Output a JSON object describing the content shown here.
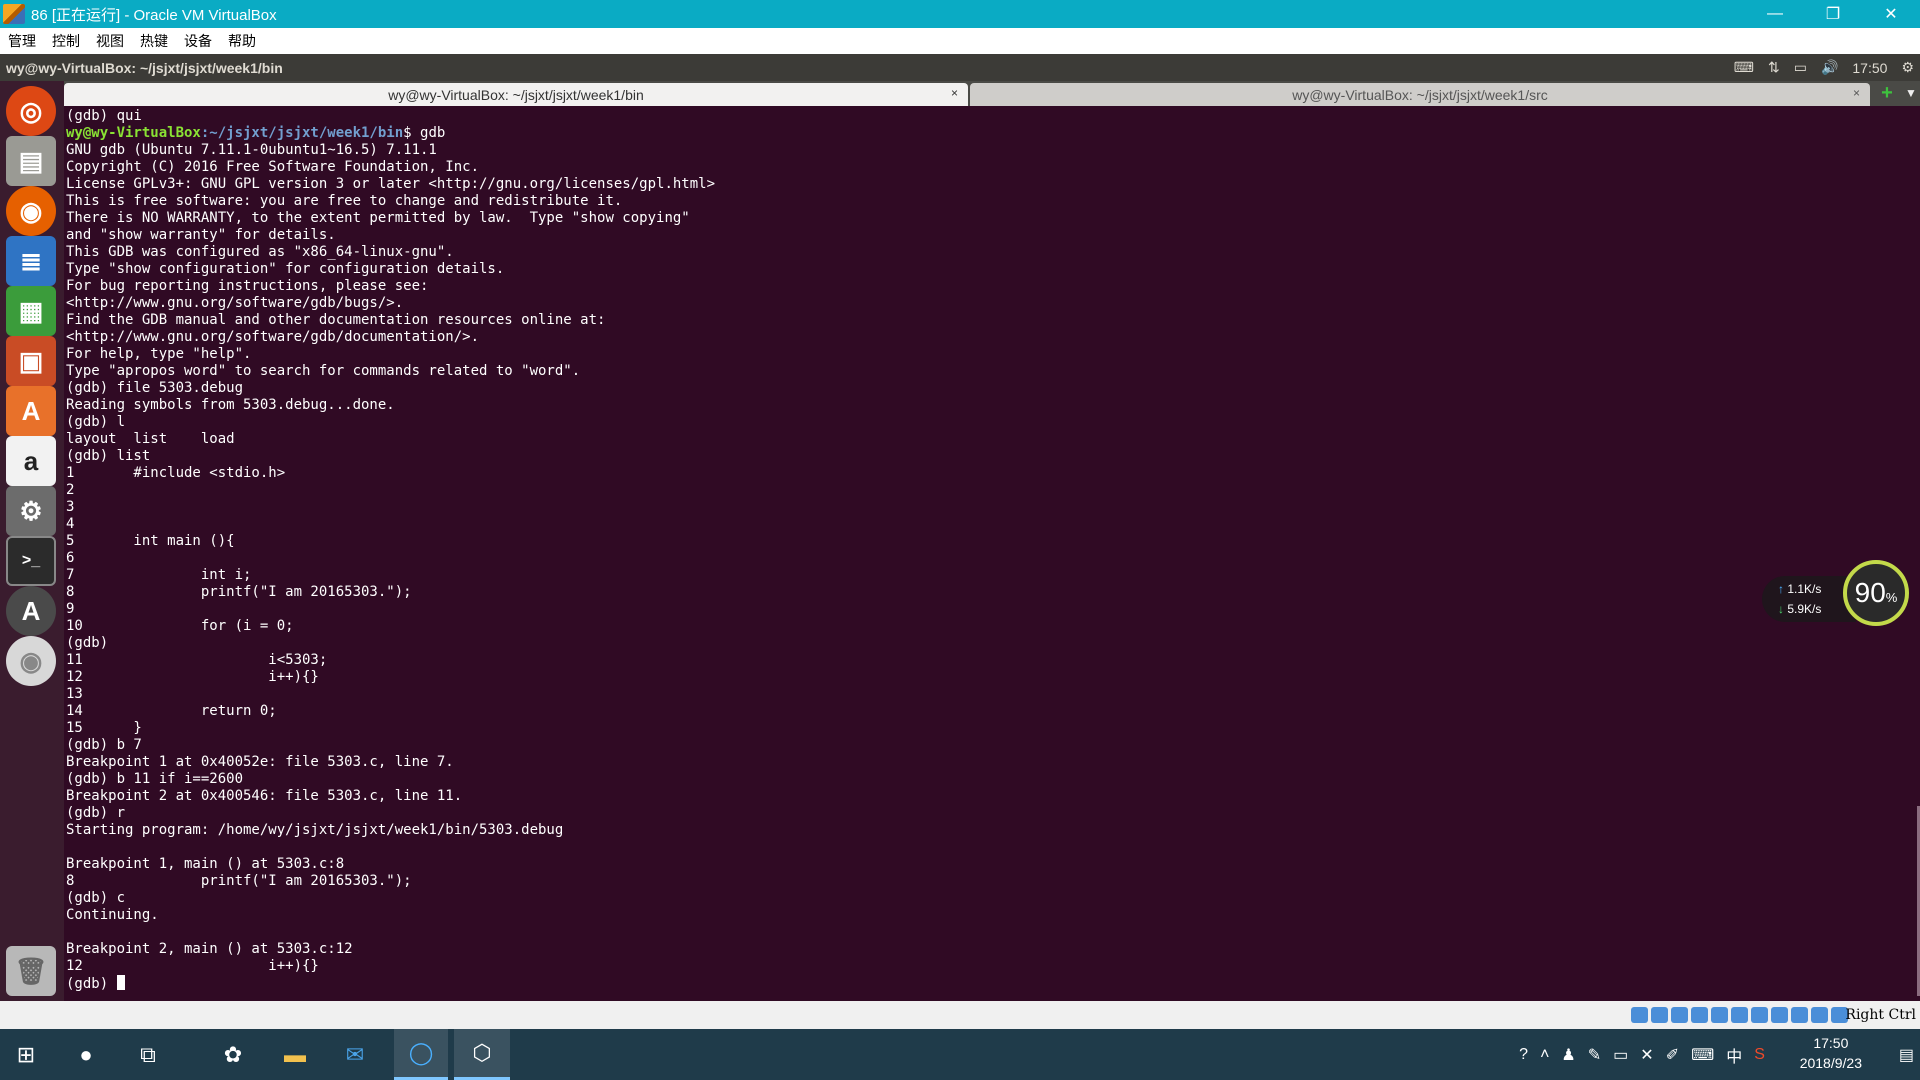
{
  "host_window": {
    "title": "86 [正在运行] - Oracle VM VirtualBox",
    "controls": [
      "—",
      "❐",
      "✕"
    ]
  },
  "vb_menu": [
    "管理",
    "控制",
    "视图",
    "热键",
    "设备",
    "帮助"
  ],
  "ubuntu_panel": {
    "title": "wy@wy-VirtualBox: ~/jsjxt/jsjxt/week1/bin",
    "time": "17:50"
  },
  "launcher_icons": [
    "ubuntu-dash-icon",
    "files-icon",
    "firefox-icon",
    "writer-icon",
    "calc-icon",
    "impress-icon",
    "software-center-icon",
    "amazon-icon",
    "system-settings-icon",
    "terminal-icon",
    "software-updater-icon",
    "dvd-icon",
    "trash-icon"
  ],
  "tabs": [
    {
      "label": "wy@wy-VirtualBox: ~/jsjxt/jsjxt/week1/bin",
      "close": "×"
    },
    {
      "label": "wy@wy-VirtualBox: ~/jsjxt/jsjxt/week1/src",
      "close": "×"
    }
  ],
  "terminal": {
    "line_first": "(gdb) qui",
    "prompt_user": "wy@wy-VirtualBox",
    "prompt_path": ":~/jsjxt/jsjxt/week1/bin",
    "prompt_cmd": "$ gdb",
    "body": "GNU gdb (Ubuntu 7.11.1-0ubuntu1~16.5) 7.11.1\nCopyright (C) 2016 Free Software Foundation, Inc.\nLicense GPLv3+: GNU GPL version 3 or later <http://gnu.org/licenses/gpl.html>\nThis is free software: you are free to change and redistribute it.\nThere is NO WARRANTY, to the extent permitted by law.  Type \"show copying\"\nand \"show warranty\" for details.\nThis GDB was configured as \"x86_64-linux-gnu\".\nType \"show configuration\" for configuration details.\nFor bug reporting instructions, please see:\n<http://www.gnu.org/software/gdb/bugs/>.\nFind the GDB manual and other documentation resources online at:\n<http://www.gnu.org/software/gdb/documentation/>.\nFor help, type \"help\".\nType \"apropos word\" to search for commands related to \"word\".\n(gdb) file 5303.debug\nReading symbols from 5303.debug...done.\n(gdb) l\nlayout  list    load\n(gdb) list\n1       #include <stdio.h>\n2\n3\n4\n5       int main (){\n6\n7               int i;\n8               printf(\"I am 20165303.\");\n9\n10              for (i = 0;\n(gdb)\n11                      i<5303;\n12                      i++){}\n13\n14              return 0;\n15      }\n(gdb) b 7\nBreakpoint 1 at 0x40052e: file 5303.c, line 7.\n(gdb) b 11 if i==2600\nBreakpoint 2 at 0x400546: file 5303.c, line 11.\n(gdb) r\nStarting program: /home/wy/jsjxt/jsjxt/week1/bin/5303.debug\n\nBreakpoint 1, main () at 5303.c:8\n8               printf(\"I am 20165303.\");\n(gdb) c\nContinuing.\n\nBreakpoint 2, main () at 5303.c:12\n12                      i++){}",
    "last_prompt": "(gdb) "
  },
  "net_widget": {
    "upload": "1.1K/s",
    "download": "5.9K/s",
    "percent": "90",
    "percent_unit": "%"
  },
  "statusbar": {
    "host_key": "Right Ctrl"
  },
  "taskbar": {
    "time": "17:50",
    "date": "2018/9/23",
    "ime": "中"
  }
}
